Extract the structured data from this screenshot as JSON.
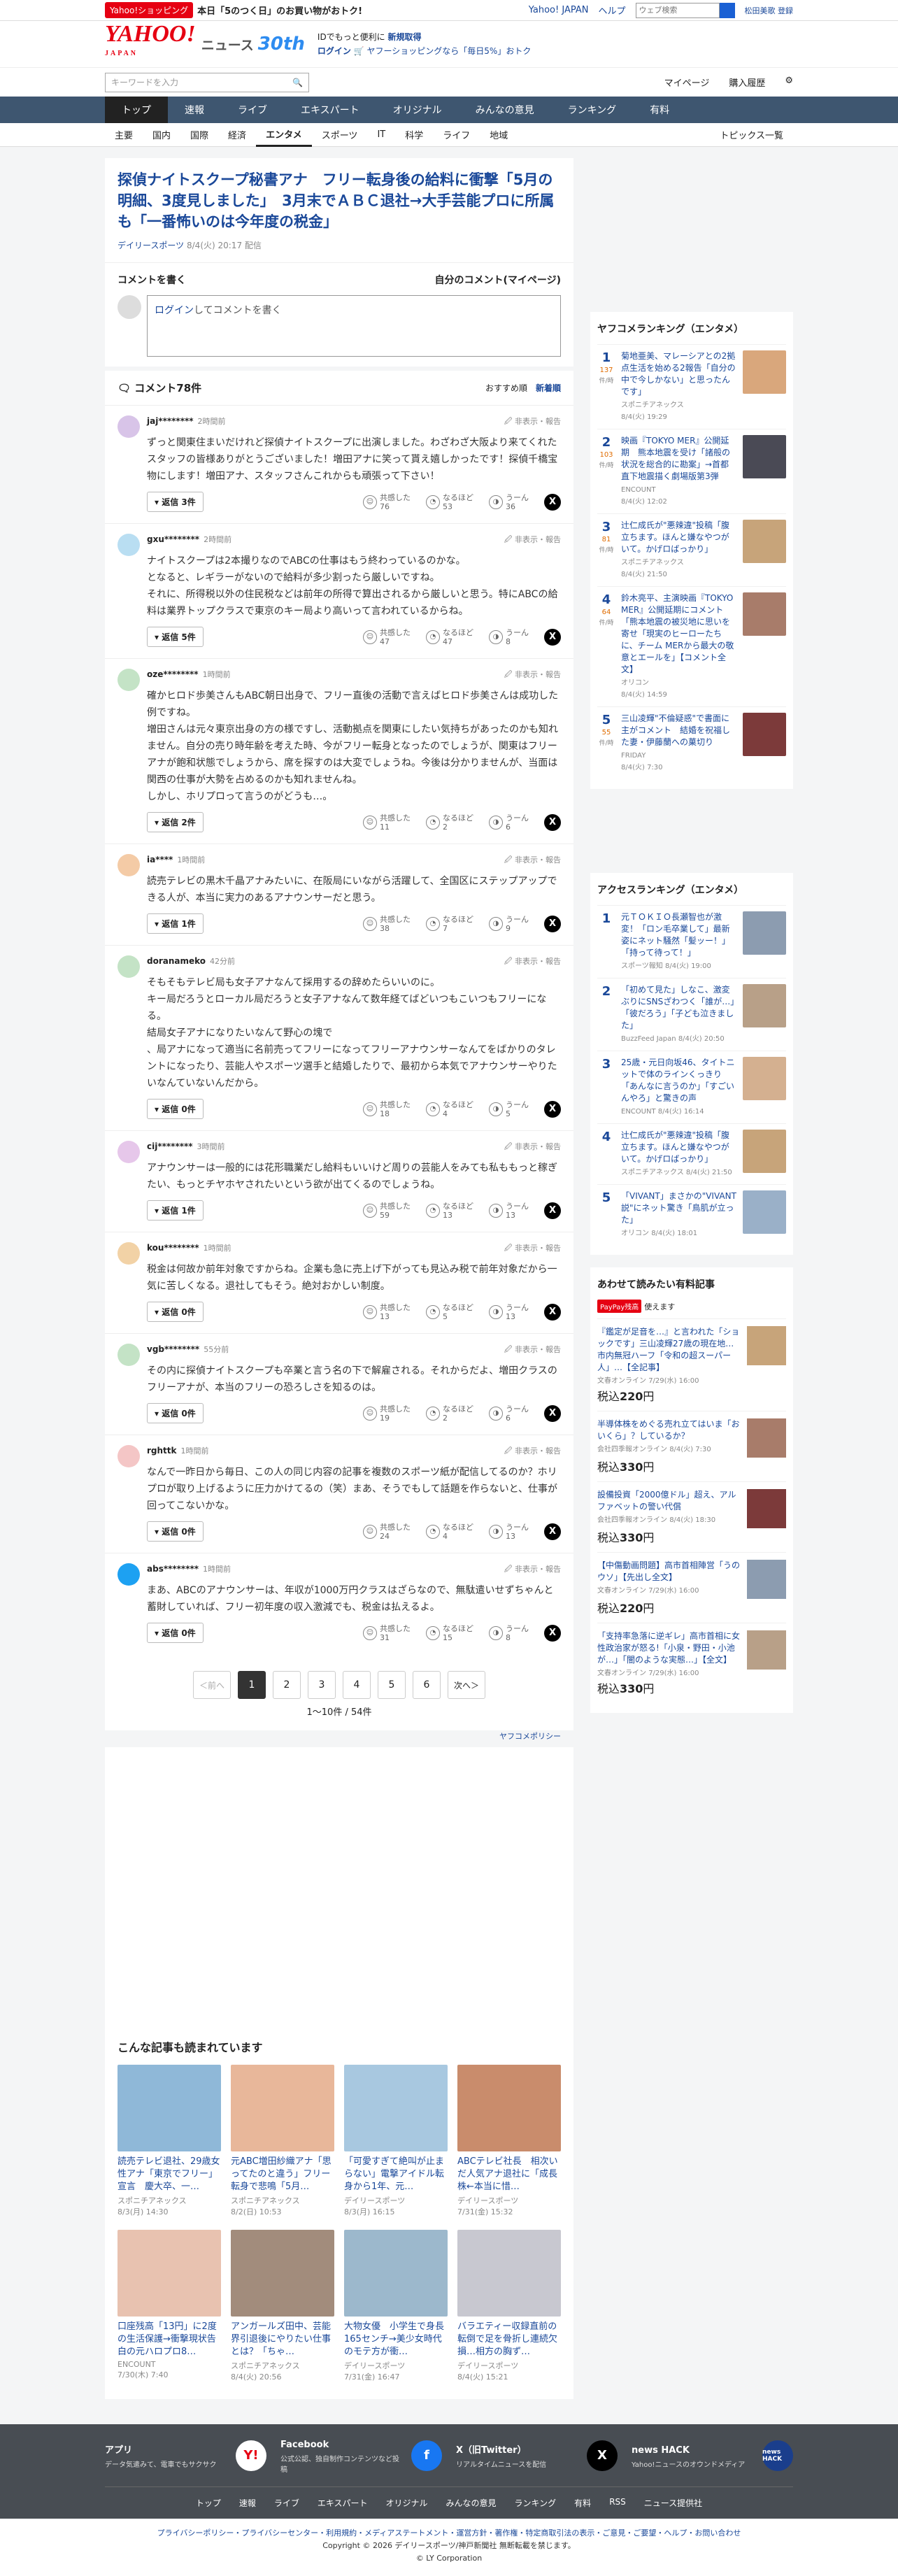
{
  "topbar": {
    "badge": "Yahoo!ショッピング",
    "promo": "本日「5のつく日」のお買い物がおトク!",
    "links": [
      "Yahoo! JAPAN",
      "ヘルプ"
    ],
    "search_placeholder": "ウェブ検索",
    "user": "松田美歌 登録"
  },
  "header": {
    "logo": "YAHOO!",
    "logo_sub": "JAPAN",
    "news": "ニュース",
    "anniv": "30th",
    "msg1": "IDでもっと便利に",
    "msg1b": "新規取得",
    "msg2a": "ログイン",
    "msg2b": "ヤフーショッピングなら「毎日5%」おトク"
  },
  "search": {
    "placeholder": "キーワードを入力",
    "links": [
      "マイページ",
      "購入履歴"
    ]
  },
  "gnav": [
    "トップ",
    "速報",
    "ライブ",
    "エキスパート",
    "オリジナル",
    "みんなの意見",
    "ランキング",
    "有料"
  ],
  "snav": [
    "主要",
    "国内",
    "国際",
    "経済",
    "エンタメ",
    "スポーツ",
    "IT",
    "科学",
    "ライフ",
    "地域"
  ],
  "snav_right": "トピックス一覧",
  "article": {
    "title": "探偵ナイトスクープ秘書アナ　フリー転身後の給料に衝撃「5月の明細、3度見しました」　3月末でＡＢＣ退社→大手芸能プロに所属も「一番怖いのは今年度の税金」",
    "source": "デイリースポーツ",
    "date": "8/4(火) 20:17 配信"
  },
  "write": {
    "heading": "コメントを書く",
    "my": "自分のコメント(マイページ)",
    "login": "ログイン",
    "rest": "してコメントを書く"
  },
  "comments_head": {
    "title": "コメント78件",
    "sort1": "おすすめ順",
    "sort2": "新着順"
  },
  "common": {
    "report": "非表示・報告",
    "like": "共感した",
    "hmm": "なるほど",
    "uun": "うーん"
  },
  "comments": [
    {
      "user": "jaj********",
      "time": "2時間前",
      "text": "ずっと関東住まいだけれど探偵ナイトスクープに出演しました。わざわざ大阪より来てくれたスタッフの皆様ありがとうございました！増田アナに笑って貰え嬉しかったです！探偵千橋宝物にします！増田アナ、スタッフさんこれからも頑張って下さい！",
      "reply": "返信 3件",
      "c1": "76",
      "c2": "53",
      "c3": "36"
    },
    {
      "user": "gxu********",
      "time": "2時間前",
      "text": "ナイトスクープは2本撮りなのでABCの仕事はもう終わっているのかな。\nとなると、レギラーがないので給料が多少割ったら厳しいですね。\nそれに、所得税以外の住民税などは前年の所得で算出されるから厳しいと思う。特にABCの給料は業界トップクラスで東京のキー局より高いって言われているからね。",
      "reply": "返信 5件",
      "c1": "47",
      "c2": "47",
      "c3": "8"
    },
    {
      "user": "oze********",
      "time": "1時間前",
      "text": "確かヒロド歩美さんもABC朝日出身で、フリー直後の活動で言えばヒロド歩美さんは成功した例ですね。\n増田さんは元々東京出身の方の様ですし、活動拠点を関東にしたい気持ちがあったのかも知れません。自分の売り時年齢を考えた時、今がフリー転身となったのでしょうが、関東はフリーアナが飽和状態でしょうから、席を探すのは大変でしょうね。今後は分かりませんが、当面は関西の仕事が大勢を占めるのかも知れませんね。\nしかし、ホリプロって言うのがどうも…。",
      "reply": "返信 2件",
      "c1": "11",
      "c2": "2",
      "c3": "6"
    },
    {
      "user": "ia****",
      "time": "1時間前",
      "text": "読売テレビの黒木千晶アナみたいに、在阪局にいながら活躍して、全国区にステップアップできる人が、本当に実力のあるアナウンサーだと思う。",
      "reply": "返信 1件",
      "c1": "38",
      "c2": "7",
      "c3": "9"
    },
    {
      "user": "doranameko",
      "time": "42分前",
      "text": "そもそもテレビ局も女子アナなんて採用するの辞めたらいいのに。\nキー局だろうとローカル局だろうと女子アナなんて数年経てばどいつもこいつもフリーになる。\n結局女子アナになりたいなんて野心の塊で\n、局アナになって適当に名前売ってフリーになってフリーアナウンサーなんてをばかりのタレントになったり、芸能人やスポーツ選手と結婚したりで、最初から本気でアナウンサーやりたいなんていないんだから。",
      "reply": "返信 0件",
      "c1": "18",
      "c2": "4",
      "c3": "5"
    },
    {
      "user": "cij********",
      "time": "3時間前",
      "text": "アナウンサーは一般的には花形職業だし給料もいいけど周りの芸能人をみても私ももっと稼ぎたい、もっとチヤホヤされたいという欲が出てくるのでしょうね。",
      "reply": "返信 1件",
      "c1": "59",
      "c2": "13",
      "c3": "13"
    },
    {
      "user": "kou********",
      "time": "1時間前",
      "text": "税金は何故か前年対象ですからね。企業も急に売上げ下がっても見込み税で前年対象だから一気に苦しくなる。退社してもそう。絶対おかしい制度。",
      "reply": "返信 0件",
      "c1": "13",
      "c2": "5",
      "c3": "13"
    },
    {
      "user": "vgb********",
      "time": "55分前",
      "text": "その内に探偵ナイトスクープも卒業と言う名の下で解雇される。それからだよ、増田クラスのフリーアナが、本当のフリーの恐ろしさを知るのは。",
      "reply": "返信 0件",
      "c1": "19",
      "c2": "2",
      "c3": "6"
    },
    {
      "user": "rghttk",
      "time": "1時間前",
      "text": "なんで一昨日から毎日、この人の同じ内容の記事を複数のスポーツ紙が配信してるのか？ホリプロが取り上げるように圧力かけてるの（笑）まあ、そうでもして話題を作らないと、仕事が回ってこないかな。",
      "reply": "返信 0件",
      "c1": "24",
      "c2": "4",
      "c3": "13"
    },
    {
      "user": "abs********",
      "time": "1時間前",
      "text": "まあ、ABCのアナウンサーは、年収が1000万円クラスはざらなので、無駄遣いせずちゃんと蓄財していれば、フリー初年度の収入激減でも、税金は払えるよ。",
      "reply": "返信 0件",
      "c1": "31",
      "c2": "15",
      "c3": "8"
    }
  ],
  "pager": {
    "prev": "＜前へ",
    "pages": [
      "1",
      "2",
      "3",
      "4",
      "5",
      "6"
    ],
    "next": "次へ＞",
    "count": "1〜10件 / 54件"
  },
  "policy": "ヤフコメポリシー",
  "related": {
    "heading": "こんな記事も読まれています",
    "items": [
      {
        "title": "読売テレビ退社、29歳女性アナ「東京でフリー」宣言　慶大卒、一…",
        "src": "スポニチアネックス",
        "date": "8/3(月) 14:30"
      },
      {
        "title": "元ABC増田紗織アナ「思ってたのと違う」フリー転身で悲鳴「5月…",
        "src": "スポニチアネックス",
        "date": "8/2(日) 10:53"
      },
      {
        "title": "「可愛すぎて絶叫が止まらない」電撃アイドル転身から1年、元…",
        "src": "デイリースポーツ",
        "date": "8/3(月) 16:15"
      },
      {
        "title": "ABCテレビ社長　相次いだ人気アナ退社に「成長株←本当に惜…",
        "src": "デイリースポーツ",
        "date": "7/31(金) 15:32"
      },
      {
        "title": "口座残高「13円」に2度の生活保護→衝撃現状告白の元ハロプロ8…",
        "src": "ENCOUNT",
        "date": "7/30(木) 7:40"
      },
      {
        "title": "アンガールズ田中、芸能界引退後にやりたい仕事とは？「ちゃ…",
        "src": "スポニチアネックス",
        "date": "8/4(火) 20:56"
      },
      {
        "title": "大物女優　小学生で身長165センチ→美少女時代のモテ方が衝…",
        "src": "デイリースポーツ",
        "date": "7/31(金) 16:47"
      },
      {
        "title": "バラエティー収録直前の転倒で足を骨折し連続欠損…相方の胸ず…",
        "src": "デイリースポーツ",
        "date": "8/4(火) 15:21"
      }
    ]
  },
  "yafucome": {
    "heading": "ヤフコメランキング（エンタメ）",
    "unit": "件/時",
    "items": [
      {
        "rank": "1",
        "count": "137",
        "title": "菊地亜美、マレーシアとの2拠点生活を始める2報告「自分の中で今しかない」と思ったんです」",
        "src": "スポニチアネックス",
        "date": "8/4(火) 19:29"
      },
      {
        "rank": "2",
        "count": "103",
        "title": "映画『TOKYO MER』公開延期　熊本地震を受け「諸般の状況を総合的に勘案」→首都直下地震描く劇場版第3弾",
        "src": "ENCOUNT",
        "date": "8/4(火) 12:02"
      },
      {
        "rank": "3",
        "count": "81",
        "title": "辻仁成氏が\"悪辣違\"投稿「腹立ちます。ほんと嫌なやつがいて。かげロばっかり」",
        "src": "スポニチアネックス",
        "date": "8/4(火) 21:50"
      },
      {
        "rank": "4",
        "count": "64",
        "title": "鈴木亮平、主演映画『TOKYO MER』公開延期にコメント「熊本地震の被災地に思いを寄せ「現実のヒーローたちに、チーム MERから最大の敬意とエールを」【コメント全文】",
        "src": "オリコン",
        "date": "8/4(火) 14:59"
      },
      {
        "rank": "5",
        "count": "55",
        "title": "三山凌輝\"不倫疑惑\"で書面に主がコメント　結婚を祝福した妻・伊藤蘭への菓切り",
        "src": "FRIDAY",
        "date": "8/4(火) 7:30"
      }
    ]
  },
  "access": {
    "heading": "アクセスランキング（エンタメ）",
    "items": [
      {
        "rank": "1",
        "title": "元ＴＯＫＩＯ長瀬智也が激変！「ロン毛卒業して」最新姿にネット騒然「髪ッー！」「持って待って！」",
        "src": "スポーツ報知",
        "date": "8/4(火) 19:00"
      },
      {
        "rank": "2",
        "title": "「初めて見た」しなこ、激変ぶりにSNSざわつく「誰が…」「彼だろう」「子ども泣きました」",
        "src": "BuzzFeed Japan",
        "date": "8/4(火) 20:50"
      },
      {
        "rank": "3",
        "title": "25歳・元日向坂46、タイトニットで体のラインくっきり「あんなに言うのか」「すごいんやろ」と驚きの声",
        "src": "ENCOUNT",
        "date": "8/4(火) 16:14"
      },
      {
        "rank": "4",
        "title": "辻仁成氏が\"悪辣違\"投稿「腹立ちます。ほんと嫌なやつがいて。かげロばっかり」",
        "src": "スポニチアネックス",
        "date": "8/4(火) 21:50"
      },
      {
        "rank": "5",
        "title": "「VIVANT」まさかの\"VIVANT説\"にネット驚き「鳥肌が立った」",
        "src": "オリコン",
        "date": "8/4(火) 18:01"
      }
    ]
  },
  "paid": {
    "heading": "あわせて読みたい有料記事",
    "paypay": "PayPay残高",
    "paypay_rest": "使えます",
    "items": [
      {
        "title": "『鑑定が足音を…』と言われた「ショックです」三山凌輝27歳の現在地…市内無冠ハーフ「令和の超スーパー人」…【全記事】",
        "src": "文春オンライン",
        "date": "7/29(水) 16:00",
        "price": "220"
      },
      {
        "title": "半導体株をめぐる売れ立てはいま「おいくら」？しているか？",
        "src": "会社四季報オンライン",
        "date": "8/4(火) 7:30",
        "price": "330"
      },
      {
        "title": "設備投資「2000億ドル」超え、アルファベットの警い代償",
        "src": "会社四季報オンライン",
        "date": "8/4(火) 18:30",
        "price": "330"
      },
      {
        "title": "【中傷動画問題】高市首相陣営「うのウソ」【先出し全文】",
        "src": "文春オンライン",
        "date": "7/29(水) 16:00",
        "price": "220"
      },
      {
        "title": "「支持率急落に逆ギレ」高市首相に女性政治家が怒る!「小泉・野田・小池が…」「闇のような実態…」【全文】",
        "src": "文春オンライン",
        "date": "7/29(水) 16:00",
        "price": "330"
      }
    ],
    "price_prefix": "税込",
    "price_suffix": "円"
  },
  "footer": {
    "apps": [
      {
        "title": "アプリ",
        "desc": "データ気遣みて、電車でもサクサク",
        "icon": "Y!"
      },
      {
        "title": "Facebook",
        "desc": "公式公認、独自制作コンテンツなど投稿",
        "icon": "f"
      },
      {
        "title": "X（旧Twitter）",
        "desc": "リアルタイムニュースを配信",
        "icon": "X"
      },
      {
        "title": "news HACK",
        "desc": "Yahoo!ニュースのオウンドメディア",
        "icon": "news HACK"
      }
    ],
    "nav": [
      "トップ",
      "速報",
      "ライブ",
      "エキスパート",
      "オリジナル",
      "みんなの意見",
      "ランキング",
      "有料",
      "RSS",
      "ニュース提供社"
    ],
    "legal": "プライバシーポリシー・プライバシーセンター・利用規約・メディアステートメント・運営方針・著作権・特定商取引法の表示・ご意見・ご要望・ヘルプ・お問い合わせ",
    "copy1": "Copyright © 2026 デイリースポーツ/神戸新聞社 無断転載を禁じます。",
    "copy2": "© LY Corporation"
  }
}
